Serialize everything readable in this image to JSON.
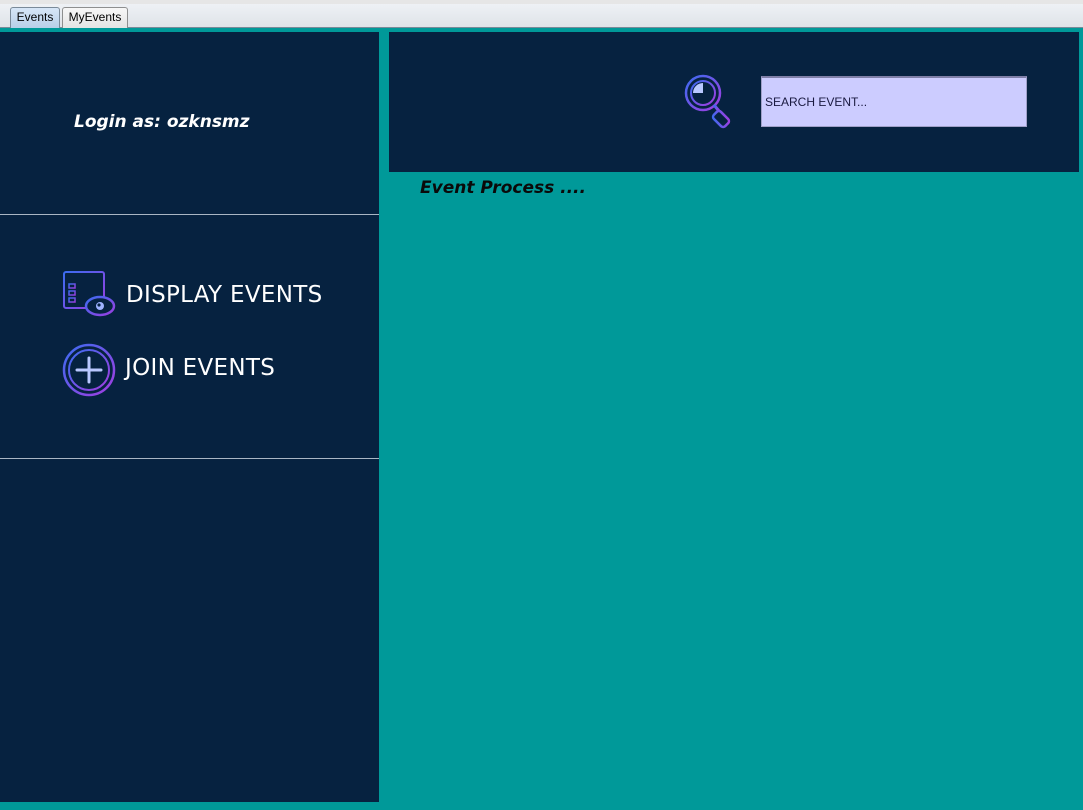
{
  "tabs": [
    {
      "label": "Events",
      "active": true
    },
    {
      "label": "MyEvents",
      "active": false
    }
  ],
  "sidebar": {
    "login_text": "Login as: ozknsmz",
    "menu": [
      {
        "label": "DISPLAY EVENTS",
        "icon": "display-events-icon"
      },
      {
        "label": "JOIN EVENTS",
        "icon": "add-circle-icon"
      }
    ]
  },
  "header": {
    "search": {
      "placeholder": "SEARCH EVENT...",
      "value": "",
      "icon": "search-icon"
    }
  },
  "main": {
    "status_text": "Event Process ...."
  },
  "colors": {
    "sidebar_bg": "#062240",
    "content_bg": "#009999",
    "search_bg": "#ccccff",
    "icon_accent": "#7b3ff2"
  }
}
